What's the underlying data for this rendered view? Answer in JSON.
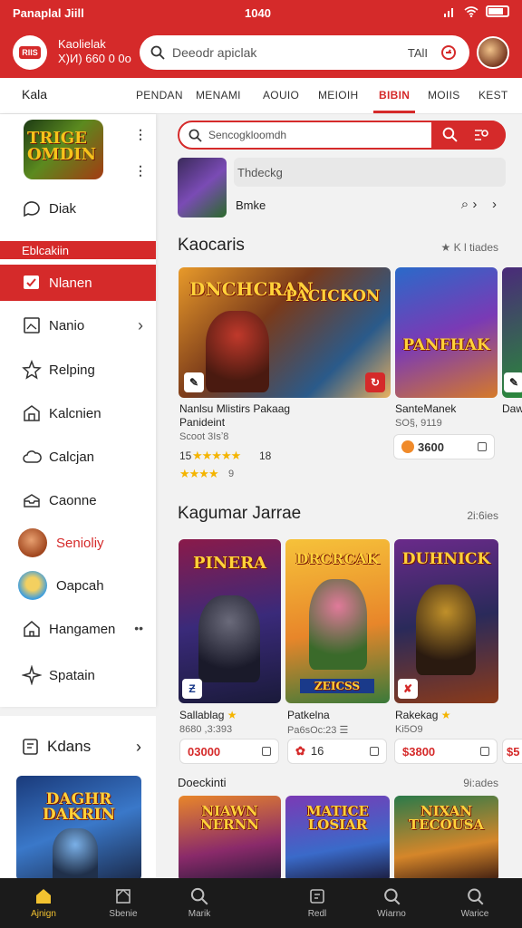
{
  "status": {
    "left": "Panaplal Jiill",
    "center": "1040",
    "battery_level": 0.8
  },
  "header": {
    "logo_text": "RIIS",
    "brand_line1": "Kaolielak",
    "brand_line2": "Х)И) 660 0 0o",
    "search_placeholder": "Deeodr apiclak",
    "search_tag": "TAlI"
  },
  "tabs": {
    "home": "Kala",
    "items": [
      "PENDAN",
      "MENAMI",
      "AOUIO",
      "MEIOIH",
      "BIBIN",
      "MOIIS",
      "KEST"
    ],
    "active_index": 4
  },
  "sidebar": {
    "featured_title": "TRIGE OMDIN",
    "top_item": "Diak",
    "section_label": "Eblcakiin",
    "items": [
      {
        "label": "Nlanen",
        "icon": "checkbox-icon"
      },
      {
        "label": "Nanio",
        "icon": "image-icon"
      },
      {
        "label": "Relping",
        "icon": "star-icon"
      },
      {
        "label": "Kalcnien",
        "icon": "store-icon"
      },
      {
        "label": "Calcjan",
        "icon": "cloud-icon"
      },
      {
        "label": "Caonne",
        "icon": "inbox-icon"
      },
      {
        "label": "Senioliy",
        "icon": "profile-avatar-icon"
      },
      {
        "label": "Oapcah",
        "icon": "user-avatar-icon"
      },
      {
        "label": "Hangamen",
        "icon": "home-icon"
      },
      {
        "label": "Spatain",
        "icon": "sparkle-icon"
      }
    ],
    "kdans_label": "Kdans",
    "kdans_poster_title": "DAGHR DAKRIN"
  },
  "main": {
    "search_placeholder": "Sencogkloomdh",
    "trending_bar": "Thdeckg",
    "trending_name": "Bmke",
    "section1": {
      "title": "Kaocaris",
      "right": "★ K l tiades"
    },
    "cards1": [
      {
        "poster": "DNCHCRAN",
        "poster2": "PACICKON",
        "title": "Nanlsu Mlistirs Pakaag",
        "title2": "Panideint",
        "sub": "Scoot 3Isʼ8",
        "rating_a": "15",
        "stars_a": "★★★★★",
        "count_a": "18",
        "stars_b": "★★★★",
        "rating_b": "9"
      },
      {
        "poster": "PANFHAK",
        "title": "SanteManek",
        "sub": "SO§, 9119",
        "price": "3600"
      },
      {
        "title": "Daw"
      }
    ],
    "section2": {
      "title": "Kagumar Jarrae",
      "right": "2i:6ies"
    },
    "cards2": [
      {
        "poster": "PINERA",
        "title": "Sallablag",
        "sub": "8680 ,3:393",
        "price": "03000"
      },
      {
        "poster": "DRCRCAK",
        "poster_sub": "ZEICSS",
        "title": "Patkelna",
        "sub": "Pa6sOc:23 ☰",
        "price": "16"
      },
      {
        "poster": "DUHNICK",
        "title": "Rakekag",
        "sub": "Ki5O9",
        "price": "$3800"
      }
    ],
    "section3": {
      "title": "Doeckinti",
      "right": "9i:ades"
    },
    "cards3": [
      {
        "poster": "NIAWN NERNN"
      },
      {
        "poster": "MATICE LOSIAR"
      },
      {
        "poster": "NIXAN TECOUSA"
      }
    ]
  },
  "bottom_nav": [
    "Ajnign",
    "Sbenie",
    "Marik",
    "Redl",
    "Wiarno",
    "Warice"
  ],
  "colors": {
    "accent": "#d52a2a",
    "star": "#f4b400",
    "nav_active": "#f2c230"
  }
}
